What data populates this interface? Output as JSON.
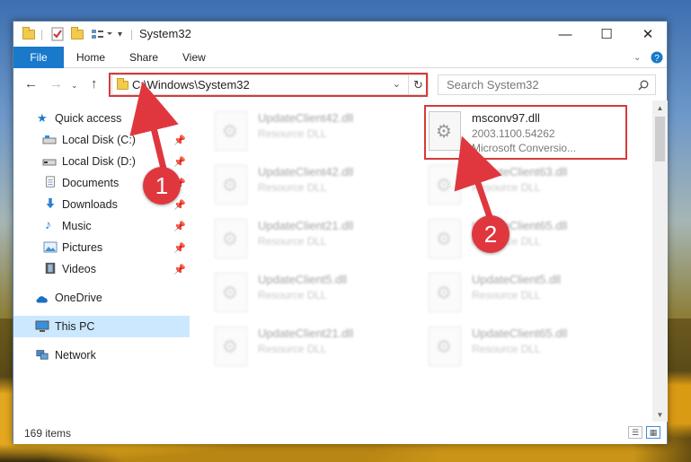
{
  "window": {
    "title": "System32",
    "controls": {
      "minimize": "—",
      "maximize": "☐",
      "close": "✕"
    }
  },
  "ribbon": {
    "tabs": [
      "File",
      "Home",
      "Share",
      "View"
    ]
  },
  "navigation": {
    "address_path": "C:\\Windows\\System32",
    "search_placeholder": "Search System32"
  },
  "sidebar": {
    "items": [
      {
        "label": "Quick access",
        "icon": "star-icon",
        "pinned": false
      },
      {
        "label": "Local Disk (C:)",
        "icon": "drive-icon",
        "pinned": true
      },
      {
        "label": "Local Disk (D:)",
        "icon": "drive-icon",
        "pinned": true
      },
      {
        "label": "Documents",
        "icon": "documents-icon",
        "pinned": true
      },
      {
        "label": "Downloads",
        "icon": "download-icon",
        "pinned": true
      },
      {
        "label": "Music",
        "icon": "music-icon",
        "pinned": true
      },
      {
        "label": "Pictures",
        "icon": "pictures-icon",
        "pinned": true
      },
      {
        "label": "Videos",
        "icon": "videos-icon",
        "pinned": true
      },
      {
        "label": "OneDrive",
        "icon": "cloud-icon",
        "pinned": false
      },
      {
        "label": "This PC",
        "icon": "computer-icon",
        "pinned": false,
        "selected": true
      },
      {
        "label": "Network",
        "icon": "network-icon",
        "pinned": false
      }
    ]
  },
  "files": {
    "left_column": [
      {
        "name": "UpdateClient42.dll",
        "type": "Resource DLL"
      },
      {
        "name": "UpdateClient42.dll",
        "type": "Resource DLL"
      },
      {
        "name": "UpdateClient21.dll",
        "type": "Resource DLL"
      },
      {
        "name": "UpdateClient5.dll",
        "type": "Resource DLL"
      },
      {
        "name": "UpdateClient21.dll",
        "type": "Resource DLL"
      }
    ],
    "highlighted": {
      "name": "msconv97.dll",
      "version": "2003.1100.54262",
      "description": "Microsoft Conversio..."
    },
    "right_column": [
      {
        "name": "UpdateClient63.dll",
        "type": "Resource DLL"
      },
      {
        "name": "UpdateClient65.dll",
        "type": "Resource DLL"
      },
      {
        "name": "UpdateClient5.dll",
        "type": "Resource DLL"
      },
      {
        "name": "UpdateClient65.dll",
        "type": "Resource DLL"
      }
    ]
  },
  "status": {
    "item_count": "169 items"
  },
  "annotations": {
    "step1": "1",
    "step2": "2",
    "color": "#e0373f"
  }
}
